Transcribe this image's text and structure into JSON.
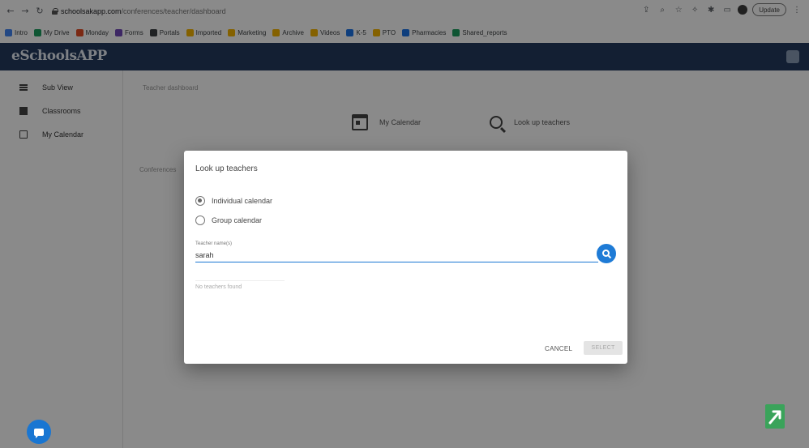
{
  "browser": {
    "url_host": "schoolsakapp.com",
    "url_path": "/conferences/teacher/dashboard",
    "update_label": "Update",
    "bookmarks": [
      {
        "label": "Intro",
        "color": "#4285f4"
      },
      {
        "label": "My Drive",
        "color": "#1a9e5f"
      },
      {
        "label": "Monday",
        "color": "#e44d26"
      },
      {
        "label": "Forms",
        "color": "#7248b9"
      },
      {
        "label": "Portals",
        "color": "#3c4043"
      },
      {
        "label": "Imported",
        "color": "#f4b400"
      },
      {
        "label": "Marketing",
        "color": "#f4b400"
      },
      {
        "label": "Archive",
        "color": "#f4b400"
      },
      {
        "label": "Videos",
        "color": "#f4b400"
      },
      {
        "label": "K-5",
        "color": "#1a73e8"
      },
      {
        "label": "PTO",
        "color": "#f4b400"
      },
      {
        "label": "Pharmacies",
        "color": "#1a73e8"
      },
      {
        "label": "Shared_reports",
        "color": "#1a9e5f"
      }
    ]
  },
  "app": {
    "logo": "eSchoolsAPP",
    "accent": "#243a5e"
  },
  "sidebar": {
    "items": [
      {
        "label": "Sub View",
        "icon": "list-icon"
      },
      {
        "label": "Classrooms",
        "icon": "grid-icon"
      },
      {
        "label": "My Calendar",
        "icon": "calendar-icon"
      }
    ]
  },
  "main": {
    "breadcrumb": "Teacher dashboard",
    "cards": [
      {
        "label": "My Calendar",
        "icon": "calendar-icon"
      },
      {
        "label": "Look up teachers",
        "icon": "search-icon"
      }
    ],
    "section_label": "Conferences"
  },
  "dialog": {
    "title": "Look up teachers",
    "options": [
      {
        "label": "Individual calendar",
        "checked": true
      },
      {
        "label": "Group calendar",
        "checked": false
      }
    ],
    "field_label": "Teacher name(s)",
    "field_value": "sarah",
    "results_note": "No teachers found",
    "cancel_label": "CANCEL",
    "select_label": "SELECT"
  }
}
